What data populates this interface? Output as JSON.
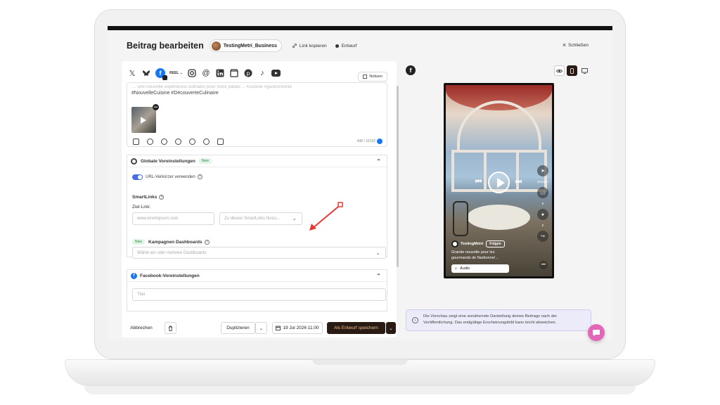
{
  "header": {
    "title": "Beitrag bearbeiten",
    "account_name": "TestingMetri_Business",
    "copy_link_label": "Link kopieren",
    "status_label": "Entwurf",
    "close_label": "Schließen"
  },
  "networks": {
    "icons": [
      "x-icon",
      "bluesky-icon",
      "facebook-icon",
      "instagram-icon",
      "threads-icon",
      "linkedin-icon",
      "google-business-icon",
      "pinterest-icon",
      "tiktok-icon",
      "youtube-icon"
    ],
    "reel_label": "REEL",
    "notes_label": "Notizen"
  },
  "caption": {
    "faded_line": "… une nouvelle expérience culinaire pour votre palais… #cuisine #gastronomie",
    "hashtags": "#NouvelleCuisine #DécouverteCulinaire",
    "char_counter": "498 / 16192"
  },
  "global_settings": {
    "title": "Globale Voreinstellungen",
    "new_badge": "New",
    "url_shortener_label": "URL-Verkürzer verwenden",
    "smartlinks_label": "SmartLinks",
    "target_link_label": "Ziel-Link:",
    "target_link_placeholder": "www.loremipsum.com",
    "smartlinks_select": "Zu diesen SmartLinks hinzu...",
    "campaign_new_badge": "New",
    "campaign_label": "Kampagnen Dashboards",
    "campaign_placeholder": "Wähle ein oder mehrere Dashboards"
  },
  "facebook_settings": {
    "title": "Facebook-Voreinstellungen",
    "title_placeholder": "Titel"
  },
  "footer": {
    "cancel_label": "Abbrechen",
    "duplicate_label": "Duplizieren",
    "date_label": "19 Jul 2026 11:00",
    "save_label": "Als Entwurf speichern"
  },
  "preview": {
    "username": "TestingMetri",
    "follow_label": "Folgen",
    "post_text": "Grande nouvelle pour les gourmands de Narbonne!…",
    "audio_label": "Audio",
    "send_label": "Senden",
    "like_count": "0",
    "comment_count": "0",
    "info_text": "Die Vorschau zeigt eine annähernde Darstellung deines Beitrags nach der Veröffentlichung. Das endgültige Erscheinungsbild kann leicht abweichen."
  },
  "colors": {
    "accent_dark": "#2a1a14",
    "save_text": "#f0c08a",
    "facebook_blue": "#1877f2",
    "toggle_blue": "#4a6ee0",
    "chat_pink": "#e466b8",
    "annotation_red": "#e53935"
  }
}
